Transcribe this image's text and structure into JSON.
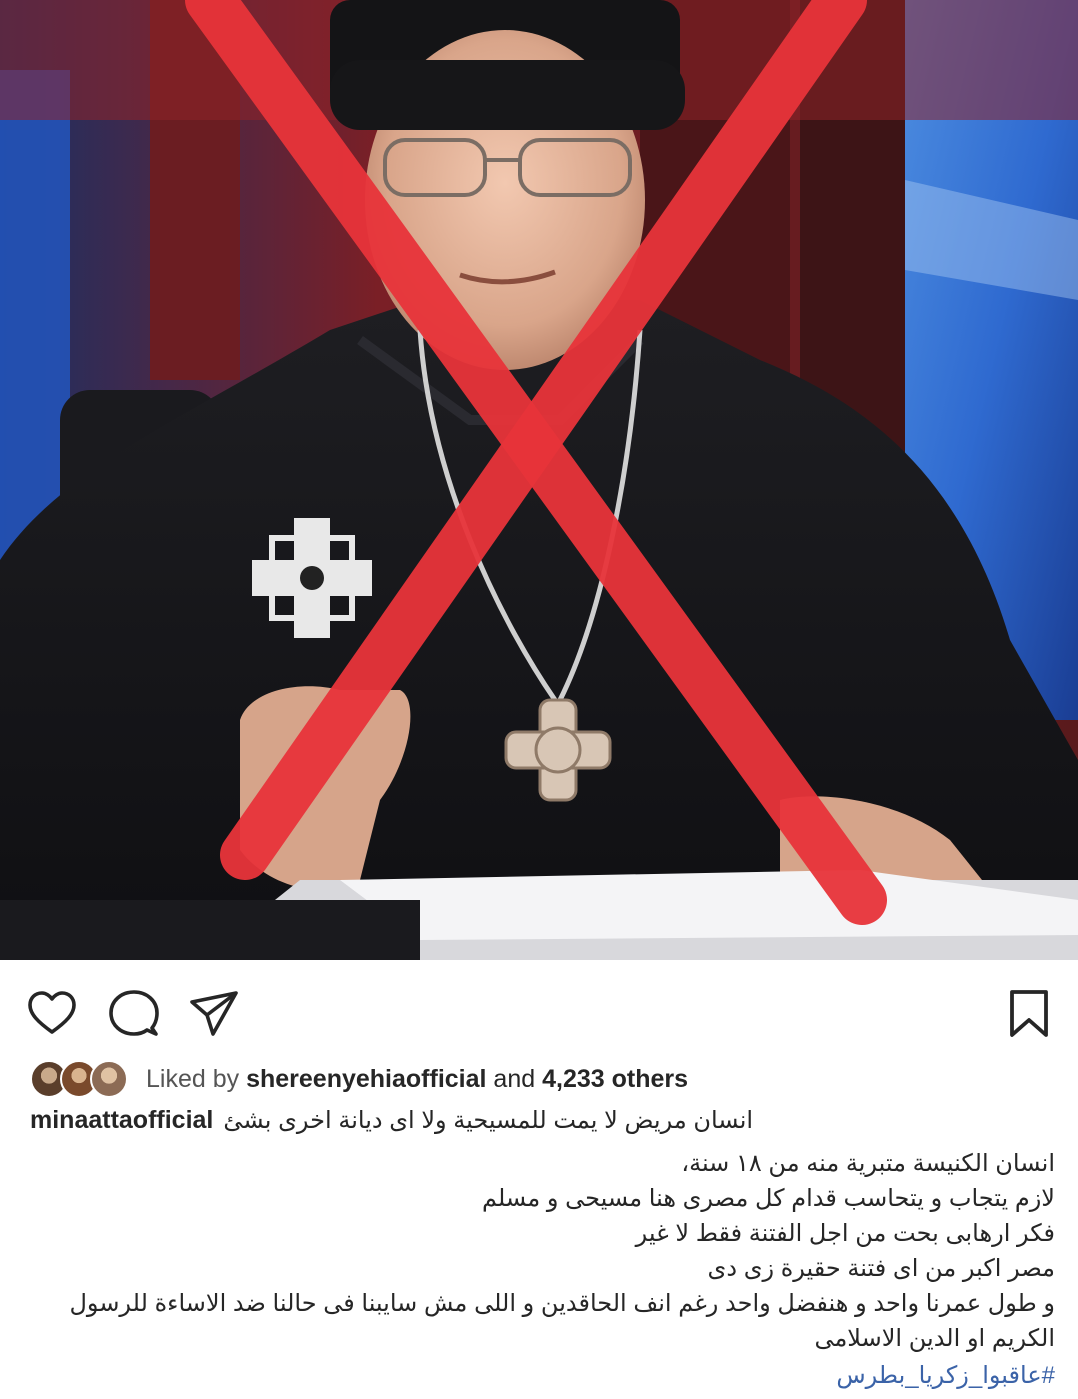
{
  "post": {
    "image_icon": "photo-of-clergyman-with-red-x",
    "accent_color": "#e8343a"
  },
  "actions": {
    "like_icon": "heart-icon",
    "comment_icon": "comment-icon",
    "share_icon": "send-icon",
    "save_icon": "bookmark-icon"
  },
  "likes": {
    "prefix": "Liked by",
    "user": "shereenyehiaofficial",
    "middle": "and",
    "others": "4,233 others"
  },
  "caption": {
    "username": "minaattaofficial",
    "lines": [
      "انسان مريض لا يمت للمسيحية ولا اى ديانة اخرى بشئ",
      "انسان الكنيسة متبرية منه من ١٨ سنة،",
      "لازم يتجاب و يتحاسب قدام كل مصرى هنا مسيحى و مسلم",
      "فكر ارهابى بحت من اجل الفتنة فقط لا غير",
      "مصر اكبر من اى فتنة حقيرة زى دى",
      "و طول عمرنا واحد و هنفضل واحد رغم انف الحاقدين و اللى مش سايبنا فى حالنا ضد الاساءة للرسول",
      "الكريم او الدين الاسلامى"
    ],
    "hashtag": "#عاقبوا_زكريا_بطرس"
  }
}
